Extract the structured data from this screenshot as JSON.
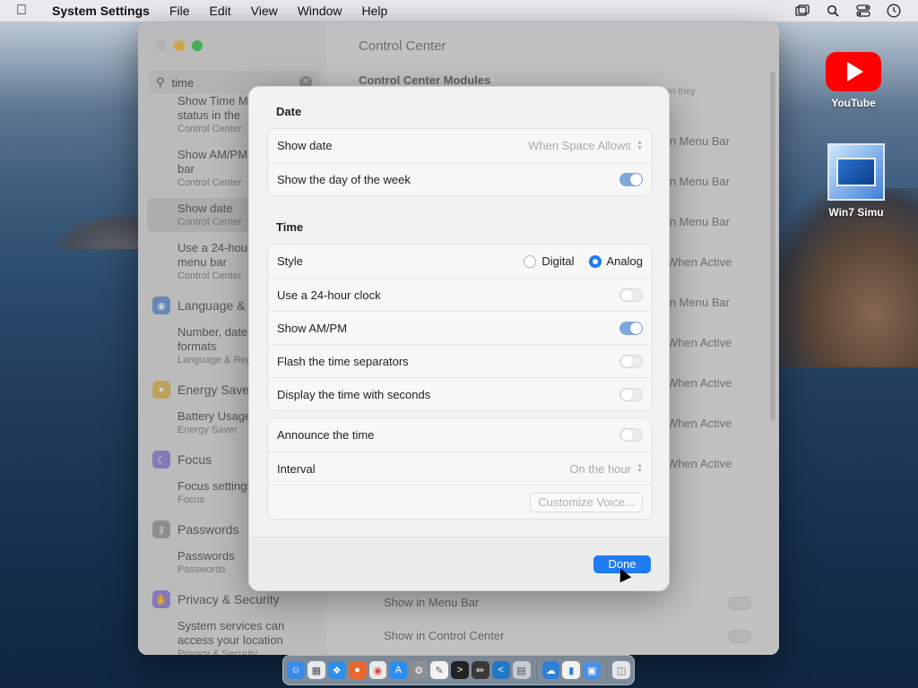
{
  "menubar": {
    "app_name": "System Settings",
    "items": [
      "File",
      "Edit",
      "View",
      "Window",
      "Help"
    ]
  },
  "desktop": {
    "icons": [
      {
        "label": "YouTube",
        "icon": "youtube-icon"
      },
      {
        "label": "Win7 Simu",
        "icon": "win7-simulator-icon"
      }
    ]
  },
  "settings": {
    "title": "Control Center",
    "search": {
      "value": "time"
    },
    "sidebar": {
      "entries": [
        {
          "main": "Show Time M...",
          "sub": "status in the",
          "detail": "Control Center"
        },
        {
          "main": "Show AM/PM in the menu bar",
          "sub": "Control Center"
        },
        {
          "main": "Show date",
          "sub": "Control Center"
        },
        {
          "main": "Use a 24-hour clock in the menu bar",
          "sub": "Control Center"
        }
      ],
      "categories": [
        {
          "label": "Language & Region",
          "icon": "globe-icon",
          "entry_main": "Number, date and time formats",
          "entry_sub": "Language & Region"
        },
        {
          "label": "Energy Saver",
          "icon": "lightbulb-icon",
          "entry_main": "Battery Usage",
          "entry_sub": "Energy Saver"
        },
        {
          "label": "Focus",
          "icon": "moon-icon",
          "entry_main": "Focus settings",
          "entry_sub": "Focus"
        },
        {
          "label": "Passwords",
          "icon": "key-icon",
          "entry_main": "Passwords",
          "entry_sub": "Passwords"
        },
        {
          "label": "Privacy & Security",
          "icon": "hand-icon",
          "entry_main": "System services can access your location",
          "entry_sub": "Privacy & Security"
        }
      ]
    },
    "main": {
      "modules_title": "Control Center Modules",
      "modules_sub": "when they",
      "module_values": [
        "in Menu Bar",
        "in Menu Bar",
        "in Menu Bar",
        "When Active",
        "in Menu Bar",
        "When Active",
        "When Active",
        "When Active",
        "When Active"
      ],
      "bottom_rows": [
        "Show in Menu Bar",
        "Show in Control Center"
      ]
    }
  },
  "dialog": {
    "date_section": {
      "heading": "Date",
      "show_date_label": "Show date",
      "show_date_value": "When Space Allows",
      "show_day_label": "Show the day of the week",
      "show_day_on": true
    },
    "time_section": {
      "heading": "Time",
      "style_label": "Style",
      "style_options": [
        "Digital",
        "Analog"
      ],
      "style_selected": "Analog",
      "rows": [
        {
          "label": "Use a 24-hour clock",
          "on": false
        },
        {
          "label": "Show AM/PM",
          "on": true
        },
        {
          "label": "Flash the time separators",
          "on": false
        },
        {
          "label": "Display the time with seconds",
          "on": false
        }
      ]
    },
    "announce_section": {
      "announce_label": "Announce the time",
      "announce_on": false,
      "interval_label": "Interval",
      "interval_value": "On the hour",
      "customize_button": "Customize Voice..."
    },
    "done_button": "Done"
  },
  "dock": {
    "apps": [
      "finder-icon",
      "launchpad-icon",
      "safari-icon",
      "firefox-icon",
      "chrome-icon",
      "app-store-icon",
      "system-settings-icon",
      "textedit-icon",
      "terminal-icon",
      "pencil-app-icon",
      "vscode-icon",
      "vm-icon",
      "weather-icon",
      "activity-icon",
      "preview-icon",
      "trash-icon"
    ]
  },
  "colors": {
    "accent": "#1f7bf2",
    "toggle_on": "#7ea7de",
    "traffic_min": "#febc2e",
    "traffic_max": "#28c840"
  }
}
